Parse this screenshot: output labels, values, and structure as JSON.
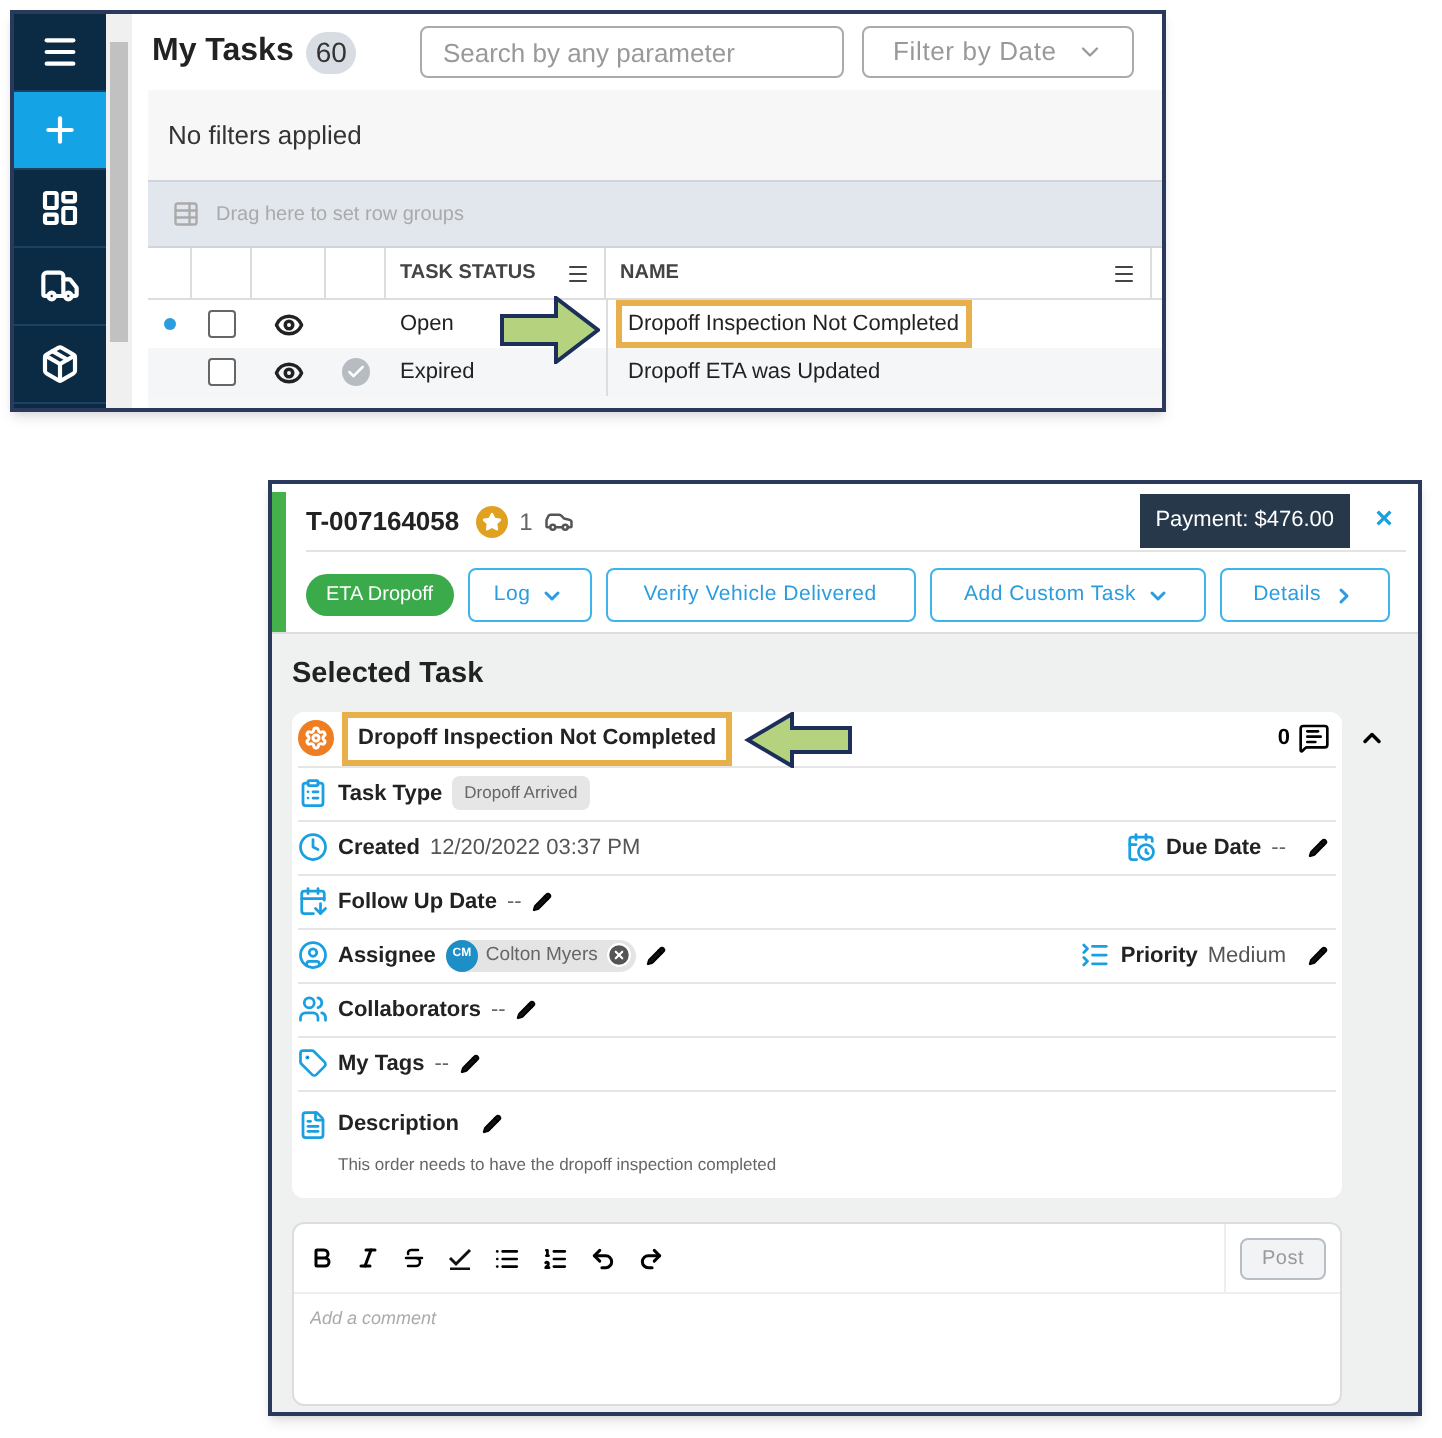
{
  "task_list": {
    "sidebar": [
      {
        "kind": "menu",
        "selected": false
      },
      {
        "kind": "add",
        "selected": true
      },
      {
        "kind": "dashboard",
        "selected": false
      },
      {
        "kind": "truck",
        "selected": false
      },
      {
        "kind": "package",
        "selected": false
      }
    ],
    "title": "My Tasks",
    "count": "60",
    "search": {
      "placeholder": "Search by any parameter"
    },
    "date_filter": {
      "label": "Filter by Date"
    },
    "filter_status": "No filters applied",
    "group_hint": "Drag here to set row groups",
    "columns": [
      "TASK STATUS",
      "NAME"
    ],
    "rows": [
      {
        "status": "Open",
        "name": "Dropoff Inspection Not Completed",
        "unread": true,
        "checked": false,
        "done": false,
        "highlighted": true
      },
      {
        "status": "Expired",
        "name": "Dropoff ETA was Updated",
        "unread": false,
        "checked": false,
        "done": true,
        "highlighted": false
      }
    ]
  },
  "order": {
    "id": "T-007164058",
    "vehicle_count": "1",
    "payment": "Payment: $476.00",
    "close": "×",
    "status_tag": {
      "label": "ETA Dropoff",
      "color": "#3aaa4a"
    },
    "actions": [
      {
        "label": "Log",
        "kind": "dropdown"
      },
      {
        "label": "Verify Vehicle Delivered",
        "kind": "plain"
      },
      {
        "label": "Add Custom Task",
        "kind": "dropdown"
      },
      {
        "label": "Details",
        "kind": "link"
      }
    ],
    "section_title": "Selected Task",
    "task": {
      "name": "Dropoff Inspection Not Completed",
      "highlighted": true,
      "comment_count": "0",
      "expanded": true,
      "rows": [
        [
          {
            "kind": "type",
            "label": "Task Type",
            "value": "Dropoff Arrived",
            "editable": false
          }
        ],
        [
          {
            "kind": "created",
            "label": "Created",
            "value": "12/20/2022 03:37 PM",
            "editable": false
          },
          {
            "kind": "due",
            "label": "Due Date",
            "value": "--",
            "editable": true
          }
        ],
        [
          {
            "kind": "followup",
            "label": "Follow Up Date",
            "value": "--",
            "editable": true
          }
        ],
        [
          {
            "kind": "assignee",
            "label": "Assignee",
            "initials": "CM",
            "value": "Colton Myers",
            "editable": true
          },
          {
            "kind": "priority",
            "label": "Priority",
            "value": "Medium",
            "editable": true
          }
        ],
        [
          {
            "kind": "collaborators",
            "label": "Collaborators",
            "value": "--",
            "editable": true
          }
        ],
        [
          {
            "kind": "tags",
            "label": "My Tags",
            "value": "--",
            "editable": true
          }
        ],
        [
          {
            "kind": "description",
            "label": "Description",
            "value": "This order needs to have the dropoff inspection completed",
            "editable": true
          }
        ]
      ]
    },
    "comment": {
      "placeholder": "Add a comment",
      "post": {
        "label": "Post",
        "disabled": true
      }
    }
  }
}
